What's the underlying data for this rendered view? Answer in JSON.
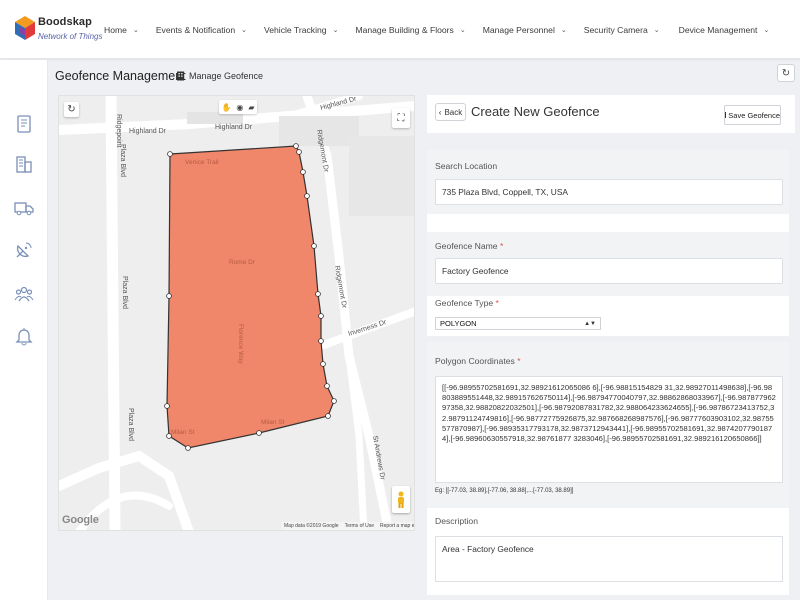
{
  "brand": {
    "name": "Boodskap",
    "tagline": "Network of Things"
  },
  "nav": {
    "items": [
      {
        "label": "Home"
      },
      {
        "label": "Events & Notification"
      },
      {
        "label": "Vehicle Tracking"
      },
      {
        "label": "Manage Building & Floors"
      },
      {
        "label": "Manage Personnel"
      },
      {
        "label": "Security Camera"
      },
      {
        "label": "Device Management"
      }
    ]
  },
  "sidebar": {
    "icons": [
      "report-icon",
      "building-icon",
      "truck-icon",
      "satellite-dish-icon",
      "users-group-icon",
      "bell-icon"
    ]
  },
  "page": {
    "title": "Geofence Management",
    "breadcrumb": "Manage Geofence"
  },
  "map": {
    "street_labels": {
      "ridgepoint": "Ridgepoint",
      "highland_1": "Highland Dr",
      "highland_2": "Highland Dr",
      "highland_3": "Highland Dr",
      "plaza_1": "Plaza Blvd",
      "plaza_2": "Plaza Blvd",
      "plaza_3": "Plaza Blvd",
      "ridgemont_1": "Ridgemont Dr",
      "ridgemont_2": "Ridgemont Dr",
      "inverness": "Inverness Dr",
      "st_andrews": "St Andrews Dr",
      "venice": "Venice Trail",
      "rome": "Rome Dr",
      "florence": "Florence Way",
      "milan_1": "Milan St",
      "milan_2": "Milan St"
    },
    "google_logo": "Google",
    "footer": {
      "data": "Map data ©2019 Google",
      "terms": "Terms of Use",
      "report": "Report a map error"
    },
    "polygon_color": "#f07e60",
    "polygon_stroke": "#333333"
  },
  "form": {
    "back_label": "Back",
    "title": "Create New Geofence",
    "save_label": "Save Geofence",
    "search_location": {
      "label": "Search Location",
      "value": "735 Plaza Blvd, Coppell, TX, USA"
    },
    "geofence_name": {
      "label": "Geofence Name",
      "required": "*",
      "value": "Factory Geofence"
    },
    "geofence_type": {
      "label": "Geofence Type",
      "required": "*",
      "value": "POLYGON"
    },
    "polygon_coordinates": {
      "label": "Polygon Coordinates",
      "required": "*",
      "value": "[[-96.98955702581691,32.98921612065086 6],[-96.98815154829 31,32.98927011498638],[-96.98803889551448,32.989157626750114],[-96.98794770040797,32.98862868033967],[-96.98787796297358,32.98820822032501],[-96.98792087831782,32.988064233624655],[-96.98786723413752,32.98791124749816],[-96.98772775926875,32.987668268987576],[-96.98777603903102,32.98755577870987],[-96.98935317793178,32.9873712943441],[-96.98955702581691,32.98742077901874],[-96.98960630557918,32.98761877 3283046],[-96.98955702581691,32.989216120650866]]",
      "hint": "Eg: [[-77.03, 38.89],[-77.06, 38.88],...[-77.03, 38.89]]"
    },
    "description": {
      "label": "Description",
      "value": "Area - Factory Geofence"
    }
  }
}
